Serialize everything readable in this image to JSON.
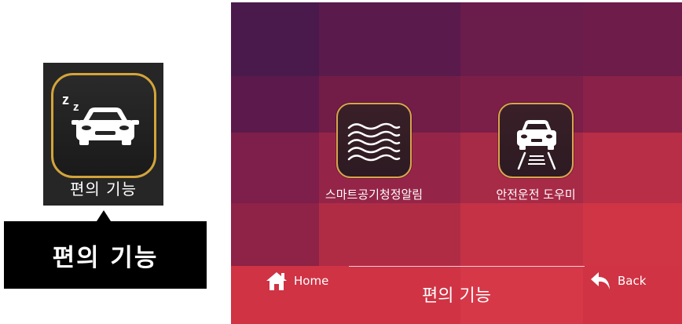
{
  "tile": {
    "label": "편의 기능",
    "icon": "sleeping-car-icon"
  },
  "tooltip": {
    "text": "편의 기능"
  },
  "screen": {
    "apps": [
      {
        "label": "스마트공기청정알림",
        "icon": "air-waves-icon"
      },
      {
        "label": "안전운전 도우미",
        "icon": "car-lane-icon"
      }
    ],
    "home_label": "Home",
    "back_label": "Back",
    "title": "편의 기능"
  },
  "colors": {
    "accent_gold": "#d4a43a",
    "tile_bg": "#262626",
    "screen_bg": "#8a1f45"
  }
}
